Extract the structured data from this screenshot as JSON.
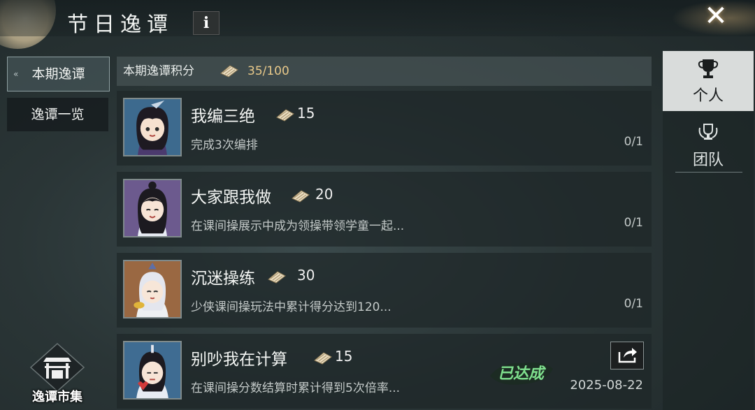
{
  "header": {
    "title": "节日逸谭",
    "info_label": "i",
    "close_label": "✕"
  },
  "nav": {
    "items": [
      {
        "label": "本期逸谭",
        "active": true
      },
      {
        "label": "逸谭一览",
        "active": false
      }
    ]
  },
  "score": {
    "label": "本期逸谭积分",
    "value": "35/100",
    "icon": "scroll-icon"
  },
  "tasks": [
    {
      "name": "我编三绝",
      "reward": "15",
      "desc": "完成3次编排",
      "progress": "0/1"
    },
    {
      "name": "大家跟我做",
      "reward": "20",
      "desc": "在课间操展示中成为领操带领学童一起...",
      "progress": "0/1"
    },
    {
      "name": "沉迷操练",
      "reward": "30",
      "desc": "少侠课间操玩法中累计得分达到120...",
      "progress": "0/1"
    },
    {
      "name": "别吵我在计算",
      "reward": "15",
      "desc": "在课间操分数结算时累计得到5次倍率...",
      "date": "2025-08-22",
      "stamp": "已达成"
    }
  ],
  "right_tabs": [
    {
      "label": "个人",
      "icon": "trophy-icon",
      "active": true
    },
    {
      "label": "团队",
      "icon": "team-trophy-icon",
      "active": false
    }
  ],
  "market": {
    "label": "逸谭市集",
    "icon": "market-gate-icon"
  },
  "colors": {
    "accent_gold": "#e8c98a",
    "panel": "#1e2628",
    "active_tab": "#d9dcdb"
  }
}
